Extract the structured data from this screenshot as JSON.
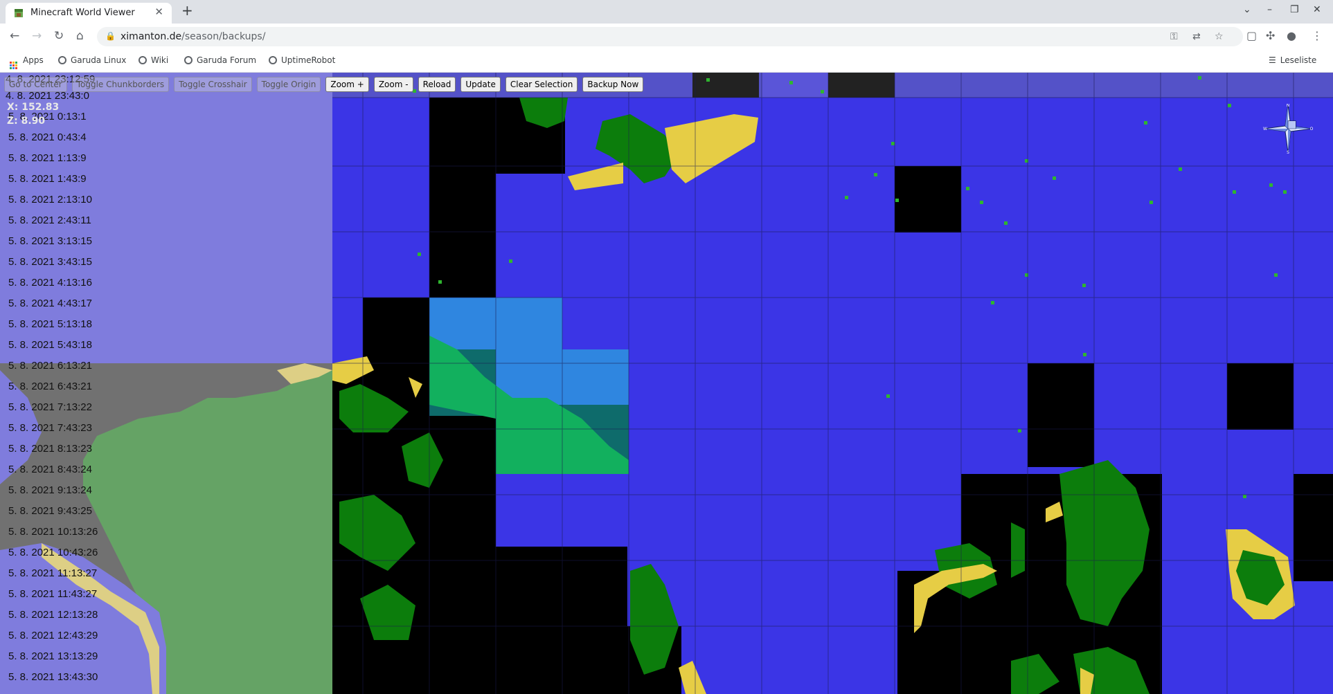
{
  "browser": {
    "tab_title": "Minecraft World Viewer",
    "url_host": "ximanton.de",
    "url_path": "/season/backups/",
    "bookmarks": [
      {
        "label": "Apps",
        "icon": "apps-grid-icon"
      },
      {
        "label": "Garuda Linux",
        "icon": "globe-icon"
      },
      {
        "label": "Wiki",
        "icon": "globe-icon"
      },
      {
        "label": "Garuda Forum",
        "icon": "globe-icon"
      },
      {
        "label": "UptimeRobot",
        "icon": "globe-icon"
      }
    ],
    "reading_list": "Leseliste"
  },
  "viewer": {
    "buttons": {
      "go_to_center": "Go to Center",
      "toggle_chunkborders": "Toggle Chunkborders",
      "toggle_crosshair": "Toggle Crosshair",
      "toggle_origin": "Toggle Origin",
      "zoom_in": "Zoom +",
      "zoom_out": "Zoom -",
      "reload": "Reload",
      "update": "Update",
      "clear_selection": "Clear Selection",
      "backup_now": "Backup Now"
    },
    "coords": {
      "x": "X: 152.83",
      "z": "Z: 8.90"
    },
    "backups": [
      "4. 8. 2021 23:12:59",
      "4. 8. 2021 23:43:0",
      "5. 8. 2021 0:13:1",
      "5. 8. 2021 0:43:4",
      "5. 8. 2021 1:13:9",
      "5. 8. 2021 1:43:9",
      "5. 8. 2021 2:13:10",
      "5. 8. 2021 2:43:11",
      "5. 8. 2021 3:13:15",
      "5. 8. 2021 3:43:15",
      "5. 8. 2021 4:13:16",
      "5. 8. 2021 4:43:17",
      "5. 8. 2021 5:13:18",
      "5. 8. 2021 5:43:18",
      "5. 8. 2021 6:13:21",
      "5. 8. 2021 6:43:21",
      "5. 8. 2021 7:13:22",
      "5. 8. 2021 7:43:23",
      "5. 8. 2021 8:13:23",
      "5. 8. 2021 8:43:24",
      "5. 8. 2021 9:13:24",
      "5. 8. 2021 9:43:25",
      "5. 8. 2021 10:13:26",
      "5. 8. 2021 10:43:26",
      "5. 8. 2021 11:13:27",
      "5. 8. 2021 11:43:27",
      "5. 8. 2021 12:13:28",
      "5. 8. 2021 12:43:29",
      "5. 8. 2021 13:13:29",
      "5. 8. 2021 13:43:30"
    ],
    "compass_letters": {
      "n": "N",
      "s": "S",
      "w": "W",
      "o": "O"
    },
    "colors": {
      "water": "#3b35e6",
      "shallow": "#2f86e0",
      "teal": "#0e6b6b",
      "grass": "#0c7d0c",
      "light_grass": "#12b05e",
      "sand": "#e6cd45",
      "unloaded": "#000000"
    }
  }
}
